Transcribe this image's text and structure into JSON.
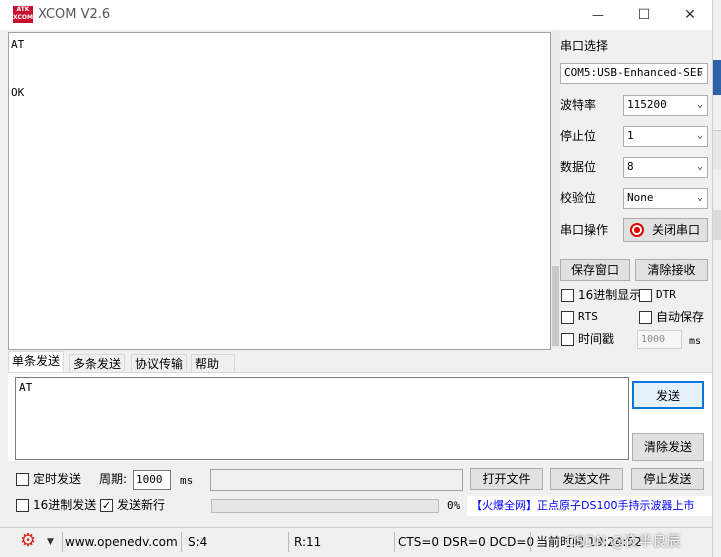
{
  "window": {
    "title": "XCOM V2.6",
    "logo": "ATK XCOM",
    "minimize": "—",
    "maximize": "☐",
    "close": "✕"
  },
  "receive": {
    "lines": [
      "AT",
      "",
      "",
      "OK"
    ]
  },
  "settings": {
    "port_select_label": "串口选择",
    "port_value": "COM5:USB-Enhanced-SEF",
    "baud_label": "波特率",
    "baud_value": "115200",
    "stop_label": "停止位",
    "stop_value": "1",
    "data_label": "数据位",
    "data_value": "8",
    "parity_label": "校验位",
    "parity_value": "None",
    "port_op_label": "串口操作",
    "port_op_button": "关闭串口",
    "save_window": "保存窗口",
    "clear_receive": "清除接收",
    "hex_display": "16进制显示",
    "dtr": "DTR",
    "rts": "RTS",
    "auto_save": "自动保存",
    "timestamp": "时间戳",
    "timestamp_value": "1000",
    "timestamp_unit": "ms"
  },
  "tabs": [
    "单条发送",
    "多条发送",
    "协议传输",
    "帮助"
  ],
  "send": {
    "text": "AT",
    "send_button": "发送",
    "clear_send": "清除发送",
    "timed_send": "定时发送",
    "period_label": "周期:",
    "period_value": "1000",
    "period_unit": "ms",
    "open_file": "打开文件",
    "send_file": "发送文件",
    "stop_send": "停止发送",
    "hex_send": "16进制发送",
    "send_newline": "发送新行",
    "progress_percent": "0%",
    "ad_text": "【火爆全网】正点原子DS100手持示波器上市"
  },
  "status": {
    "website": "www.openedv.com",
    "s": "S:4",
    "r": "R:11",
    "signals": "CTS=0 DSR=0 DCD=0",
    "time": "当前时间 19:24:52",
    "watermark": "CSDN @夜半良辰"
  },
  "colors": {
    "accent": "#0a5fd0",
    "ad": "#0000ff",
    "gear": "#d42a1d",
    "port_icon": "#e00000"
  },
  "timestamp_checked": false,
  "send_newline_checked": true,
  "progress": 0
}
